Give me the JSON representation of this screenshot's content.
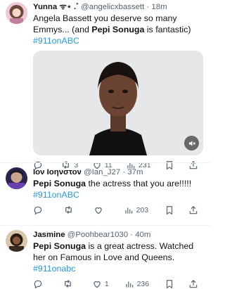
{
  "tweets": [
    {
      "name": "Yunna ᯤ⋆ .˚",
      "handle": "@angelicxbassett",
      "time": "18m",
      "text_parts": [
        "Angela Bassett you deserve so many Emmys... (and ",
        "Pepi Sonuga",
        " is fantastic) ",
        "#911onABC"
      ],
      "reply_count": "",
      "retweet_count": "3",
      "like_count": "11",
      "views": "231"
    },
    {
      "name": "Ιον Ιοηνστον",
      "handle": "@Ian_J27",
      "time": "37m",
      "text_parts": [
        "Pepi Sonuga",
        " the actress that you are!!!!! ",
        "#911onABC"
      ],
      "reply_count": "",
      "retweet_count": "",
      "like_count": "",
      "views": "203"
    },
    {
      "name": "Jasmine",
      "handle": "@Poohbear1030",
      "time": "40m",
      "text_parts": [
        "Pepi Sonuga",
        " is a great actress. Watched her on Famous in Love and Queens. ",
        "#911onabc"
      ],
      "reply_count": "",
      "retweet_count": "",
      "like_count": "1",
      "views": "236"
    }
  ],
  "separator": "·",
  "colors": {
    "accent": "#1d9bf0",
    "secondary_text": "#536471",
    "border": "#eff3f4"
  },
  "icons": [
    "reply-icon",
    "retweet-icon",
    "like-icon",
    "views-icon",
    "bookmark-icon",
    "share-icon",
    "sound-icon"
  ]
}
